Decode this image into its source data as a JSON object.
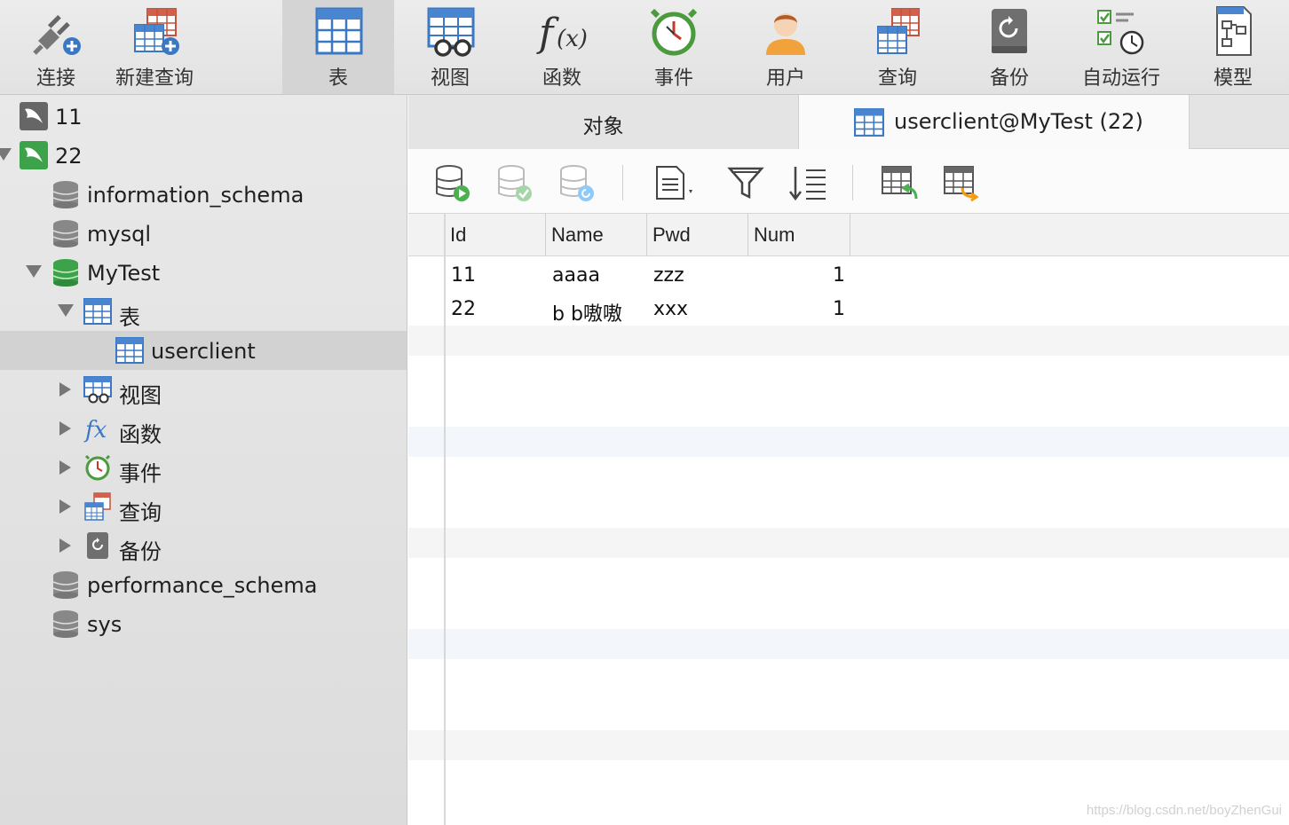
{
  "toolbar": {
    "items": [
      {
        "label": "连接",
        "icon": "plug-connect-icon"
      },
      {
        "label": "新建查询",
        "icon": "new-query-icon"
      },
      {
        "label": "表",
        "icon": "table-icon",
        "active": true
      },
      {
        "label": "视图",
        "icon": "view-glasses-icon"
      },
      {
        "label": "函数",
        "icon": "function-fx-icon"
      },
      {
        "label": "事件",
        "icon": "alarm-clock-icon"
      },
      {
        "label": "用户",
        "icon": "user-icon"
      },
      {
        "label": "查询",
        "icon": "query-icon"
      },
      {
        "label": "备份",
        "icon": "backup-icon"
      },
      {
        "label": "自动运行",
        "icon": "auto-run-icon"
      },
      {
        "label": "模型",
        "icon": "model-icon"
      }
    ]
  },
  "sidebar": {
    "conn1": "11",
    "conn2": "22",
    "db_information_schema": "information_schema",
    "db_mysql": "mysql",
    "db_mytest": "MyTest",
    "node_tables": "表",
    "table_userclient": "userclient",
    "node_views": "视图",
    "node_functions": "函数",
    "node_events": "事件",
    "node_queries": "查询",
    "node_backups": "备份",
    "db_performance_schema": "performance_schema",
    "db_sys": "sys"
  },
  "tabs": {
    "objects": "对象",
    "data": "userclient@MyTest (22)"
  },
  "grid": {
    "columns": [
      "Id",
      "Name",
      "Pwd",
      "Num"
    ],
    "rows": [
      [
        "11",
        "aaaa",
        "zzz",
        "1"
      ],
      [
        "22",
        "b b嗷嗷",
        "xxx",
        "1"
      ]
    ]
  },
  "watermark": "https://blog.csdn.net/boyZhenGui",
  "colors": {
    "accent_blue": "#3b78c4",
    "db_green": "#3da34a",
    "selected_row": "#d2d2d2"
  }
}
